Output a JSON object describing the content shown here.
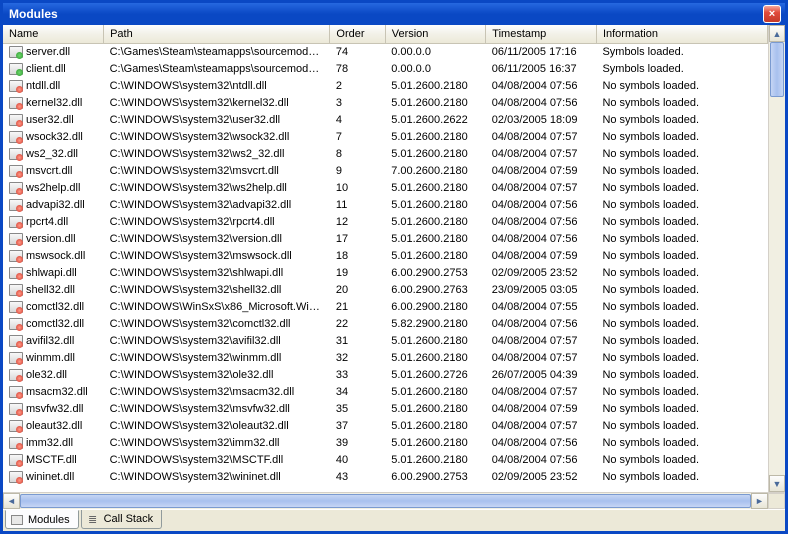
{
  "window": {
    "title": "Modules",
    "close_label": "×"
  },
  "columns": {
    "name": "Name",
    "path": "Path",
    "order": "Order",
    "version": "Version",
    "timestamp": "Timestamp",
    "information": "Information"
  },
  "rows": [
    {
      "name": "server.dll",
      "path": "C:\\Games\\Steam\\steamapps\\sourcemods\\...",
      "order": "74",
      "version": "0.00.0.0",
      "timestamp": "06/11/2005 17:16",
      "info": "Symbols loaded.",
      "loaded": true
    },
    {
      "name": "client.dll",
      "path": "C:\\Games\\Steam\\steamapps\\sourcemods\\...",
      "order": "78",
      "version": "0.00.0.0",
      "timestamp": "06/11/2005 16:37",
      "info": "Symbols loaded.",
      "loaded": true
    },
    {
      "name": "ntdll.dll",
      "path": "C:\\WINDOWS\\system32\\ntdll.dll",
      "order": "2",
      "version": "5.01.2600.2180",
      "timestamp": "04/08/2004 07:56",
      "info": "No symbols loaded.",
      "loaded": false
    },
    {
      "name": "kernel32.dll",
      "path": "C:\\WINDOWS\\system32\\kernel32.dll",
      "order": "3",
      "version": "5.01.2600.2180",
      "timestamp": "04/08/2004 07:56",
      "info": "No symbols loaded.",
      "loaded": false
    },
    {
      "name": "user32.dll",
      "path": "C:\\WINDOWS\\system32\\user32.dll",
      "order": "4",
      "version": "5.01.2600.2622",
      "timestamp": "02/03/2005 18:09",
      "info": "No symbols loaded.",
      "loaded": false
    },
    {
      "name": "wsock32.dll",
      "path": "C:\\WINDOWS\\system32\\wsock32.dll",
      "order": "7",
      "version": "5.01.2600.2180",
      "timestamp": "04/08/2004 07:57",
      "info": "No symbols loaded.",
      "loaded": false
    },
    {
      "name": "ws2_32.dll",
      "path": "C:\\WINDOWS\\system32\\ws2_32.dll",
      "order": "8",
      "version": "5.01.2600.2180",
      "timestamp": "04/08/2004 07:57",
      "info": "No symbols loaded.",
      "loaded": false
    },
    {
      "name": "msvcrt.dll",
      "path": "C:\\WINDOWS\\system32\\msvcrt.dll",
      "order": "9",
      "version": "7.00.2600.2180",
      "timestamp": "04/08/2004 07:59",
      "info": "No symbols loaded.",
      "loaded": false
    },
    {
      "name": "ws2help.dll",
      "path": "C:\\WINDOWS\\system32\\ws2help.dll",
      "order": "10",
      "version": "5.01.2600.2180",
      "timestamp": "04/08/2004 07:57",
      "info": "No symbols loaded.",
      "loaded": false
    },
    {
      "name": "advapi32.dll",
      "path": "C:\\WINDOWS\\system32\\advapi32.dll",
      "order": "11",
      "version": "5.01.2600.2180",
      "timestamp": "04/08/2004 07:56",
      "info": "No symbols loaded.",
      "loaded": false
    },
    {
      "name": "rpcrt4.dll",
      "path": "C:\\WINDOWS\\system32\\rpcrt4.dll",
      "order": "12",
      "version": "5.01.2600.2180",
      "timestamp": "04/08/2004 07:56",
      "info": "No symbols loaded.",
      "loaded": false
    },
    {
      "name": "version.dll",
      "path": "C:\\WINDOWS\\system32\\version.dll",
      "order": "17",
      "version": "5.01.2600.2180",
      "timestamp": "04/08/2004 07:56",
      "info": "No symbols loaded.",
      "loaded": false
    },
    {
      "name": "mswsock.dll",
      "path": "C:\\WINDOWS\\system32\\mswsock.dll",
      "order": "18",
      "version": "5.01.2600.2180",
      "timestamp": "04/08/2004 07:59",
      "info": "No symbols loaded.",
      "loaded": false
    },
    {
      "name": "shlwapi.dll",
      "path": "C:\\WINDOWS\\system32\\shlwapi.dll",
      "order": "19",
      "version": "6.00.2900.2753",
      "timestamp": "02/09/2005 23:52",
      "info": "No symbols loaded.",
      "loaded": false
    },
    {
      "name": "shell32.dll",
      "path": "C:\\WINDOWS\\system32\\shell32.dll",
      "order": "20",
      "version": "6.00.2900.2763",
      "timestamp": "23/09/2005 03:05",
      "info": "No symbols loaded.",
      "loaded": false
    },
    {
      "name": "comctl32.dll",
      "path": "C:\\WINDOWS\\WinSxS\\x86_Microsoft.Win...",
      "order": "21",
      "version": "6.00.2900.2180",
      "timestamp": "04/08/2004 07:55",
      "info": "No symbols loaded.",
      "loaded": false
    },
    {
      "name": "comctl32.dll",
      "path": "C:\\WINDOWS\\system32\\comctl32.dll",
      "order": "22",
      "version": "5.82.2900.2180",
      "timestamp": "04/08/2004 07:56",
      "info": "No symbols loaded.",
      "loaded": false
    },
    {
      "name": "avifil32.dll",
      "path": "C:\\WINDOWS\\system32\\avifil32.dll",
      "order": "31",
      "version": "5.01.2600.2180",
      "timestamp": "04/08/2004 07:57",
      "info": "No symbols loaded.",
      "loaded": false
    },
    {
      "name": "winmm.dll",
      "path": "C:\\WINDOWS\\system32\\winmm.dll",
      "order": "32",
      "version": "5.01.2600.2180",
      "timestamp": "04/08/2004 07:57",
      "info": "No symbols loaded.",
      "loaded": false
    },
    {
      "name": "ole32.dll",
      "path": "C:\\WINDOWS\\system32\\ole32.dll",
      "order": "33",
      "version": "5.01.2600.2726",
      "timestamp": "26/07/2005 04:39",
      "info": "No symbols loaded.",
      "loaded": false
    },
    {
      "name": "msacm32.dll",
      "path": "C:\\WINDOWS\\system32\\msacm32.dll",
      "order": "34",
      "version": "5.01.2600.2180",
      "timestamp": "04/08/2004 07:57",
      "info": "No symbols loaded.",
      "loaded": false
    },
    {
      "name": "msvfw32.dll",
      "path": "C:\\WINDOWS\\system32\\msvfw32.dll",
      "order": "35",
      "version": "5.01.2600.2180",
      "timestamp": "04/08/2004 07:59",
      "info": "No symbols loaded.",
      "loaded": false
    },
    {
      "name": "oleaut32.dll",
      "path": "C:\\WINDOWS\\system32\\oleaut32.dll",
      "order": "37",
      "version": "5.01.2600.2180",
      "timestamp": "04/08/2004 07:57",
      "info": "No symbols loaded.",
      "loaded": false
    },
    {
      "name": "imm32.dll",
      "path": "C:\\WINDOWS\\system32\\imm32.dll",
      "order": "39",
      "version": "5.01.2600.2180",
      "timestamp": "04/08/2004 07:56",
      "info": "No symbols loaded.",
      "loaded": false
    },
    {
      "name": "MSCTF.dll",
      "path": "C:\\WINDOWS\\system32\\MSCTF.dll",
      "order": "40",
      "version": "5.01.2600.2180",
      "timestamp": "04/08/2004 07:56",
      "info": "No symbols loaded.",
      "loaded": false
    },
    {
      "name": "wininet.dll",
      "path": "C:\\WINDOWS\\system32\\wininet.dll",
      "order": "43",
      "version": "6.00.2900.2753",
      "timestamp": "02/09/2005 23:52",
      "info": "No symbols loaded.",
      "loaded": false
    }
  ],
  "tabs": {
    "modules": "Modules",
    "callstack": "Call Stack"
  }
}
